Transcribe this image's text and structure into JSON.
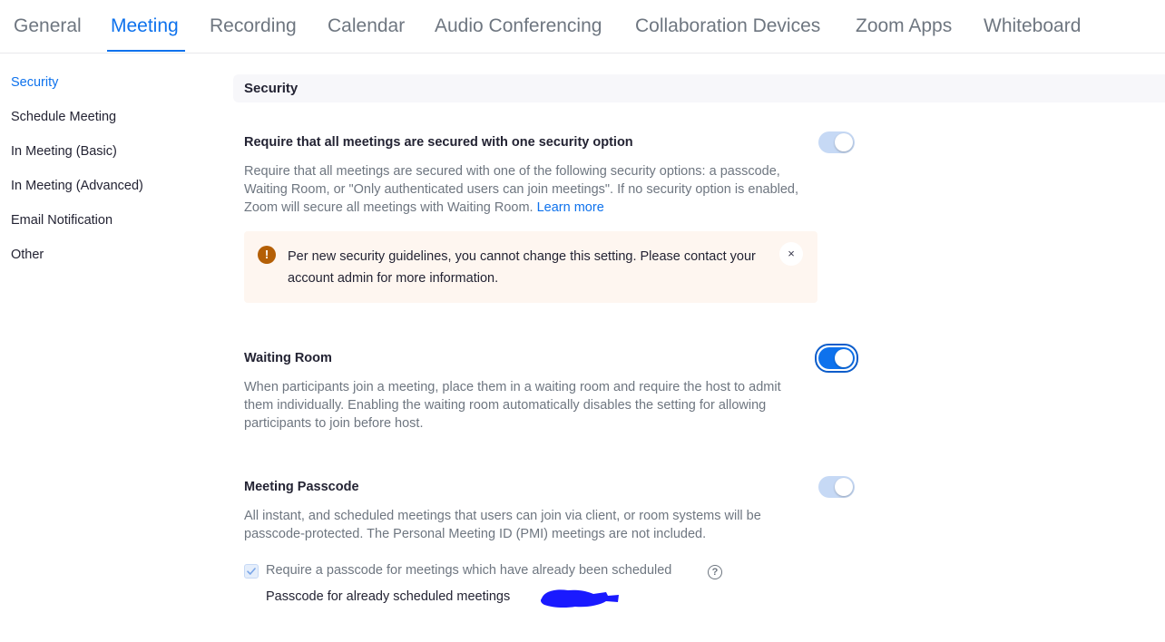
{
  "tabs": [
    {
      "label": "General"
    },
    {
      "label": "Meeting"
    },
    {
      "label": "Recording"
    },
    {
      "label": "Calendar"
    },
    {
      "label": "Audio Conferencing"
    },
    {
      "label": "Collaboration Devices"
    },
    {
      "label": "Zoom Apps"
    },
    {
      "label": "Whiteboard"
    }
  ],
  "active_tab": "Meeting",
  "sidebar": {
    "items": [
      {
        "label": "Security"
      },
      {
        "label": "Schedule Meeting"
      },
      {
        "label": "In Meeting (Basic)"
      },
      {
        "label": "In Meeting (Advanced)"
      },
      {
        "label": "Email Notification"
      },
      {
        "label": "Other"
      }
    ],
    "active_item": "Security"
  },
  "section": {
    "title": "Security"
  },
  "settings": {
    "require_security": {
      "title": "Require that all meetings are secured with one security option",
      "description": "Require that all meetings are secured with one of the following security options: a passcode, Waiting Room, or \"Only authenticated users can join meetings\". If no security option is enabled, Zoom will secure all meetings with Waiting Room.",
      "learn_more": "Learn more",
      "enabled": true,
      "locked": true
    },
    "alert": {
      "icon": "warning-icon",
      "icon_glyph": "!",
      "text": "Per new security guidelines, you cannot change this setting. Please contact your account admin for more information.",
      "close_glyph": "×"
    },
    "waiting_room": {
      "title": "Waiting Room",
      "description": "When participants join a meeting, place them in a waiting room and require the host to admit them individually. Enabling the waiting room automatically disables the setting for allowing participants to join before host.",
      "enabled": true
    },
    "meeting_passcode": {
      "title": "Meeting Passcode",
      "description": "All instant, and scheduled meetings that users can join via client, or room systems will be passcode-protected. The Personal Meeting ID (PMI) meetings are not included.",
      "enabled": true,
      "locked": true,
      "require_scheduled_label": "Require a passcode for meetings which have already been scheduled",
      "require_scheduled_checked": true,
      "help_glyph": "?",
      "scheduled_passcode_label": "Passcode for already scheduled meetings"
    }
  },
  "colors": {
    "accent": "#0e72ed",
    "toggle_locked": "#c6d9f5",
    "alert_bg": "#fef6f0",
    "warning": "#b45f06",
    "redaction": "#1a1aff"
  }
}
